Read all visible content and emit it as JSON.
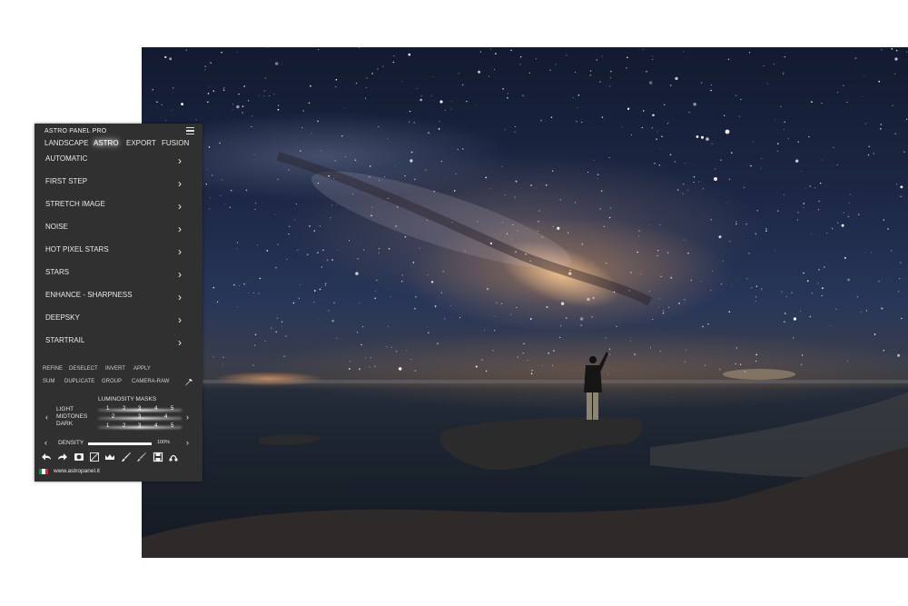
{
  "panel": {
    "title": "ASTRO PANEL PRO",
    "tabs": [
      "LANDSCAPE",
      "ASTRO",
      "EXPORT",
      "FUSION"
    ],
    "active_tab": "ASTRO",
    "menu": [
      "AUTOMATIC",
      "FIRST STEP",
      "STRETCH IMAGE",
      "NOISE",
      "HOT PIXEL STARS",
      "STARS",
      "ENHANCE - SHARPNESS",
      "DEEPSKY",
      "STARTRAIL"
    ],
    "tools_row1": [
      "REFINE",
      "DESELECT",
      "INVERT",
      "APPLY"
    ],
    "tools_row2": [
      "SUM",
      "DUPLICATE",
      "GROUP",
      "CAMERA-RAW"
    ],
    "luminosity": {
      "title": "LUMINOSITY MASKS",
      "labels": [
        "LIGHT",
        "MIDTONES",
        "DARK"
      ],
      "light": [
        "1",
        "2",
        "3",
        "4",
        "5"
      ],
      "midtones": [
        "2",
        "3",
        "4"
      ],
      "dark": [
        "1",
        "2",
        "3",
        "4",
        "5"
      ]
    },
    "density": {
      "label": "DENSITY",
      "value": "100%",
      "level": 1.0
    },
    "icons": [
      "undo-icon",
      "redo-icon",
      "mask-icon",
      "levels-icon",
      "crown-icon",
      "brush-icon",
      "soft-brush-icon",
      "save-icon",
      "share-icon"
    ],
    "footer_url": "www.astropanel.it",
    "flag_colors": [
      "#009246",
      "#ffffff",
      "#ce2b37"
    ]
  },
  "colors": {
    "panel_bg": "#303030",
    "page_bg": "#ffffff"
  }
}
